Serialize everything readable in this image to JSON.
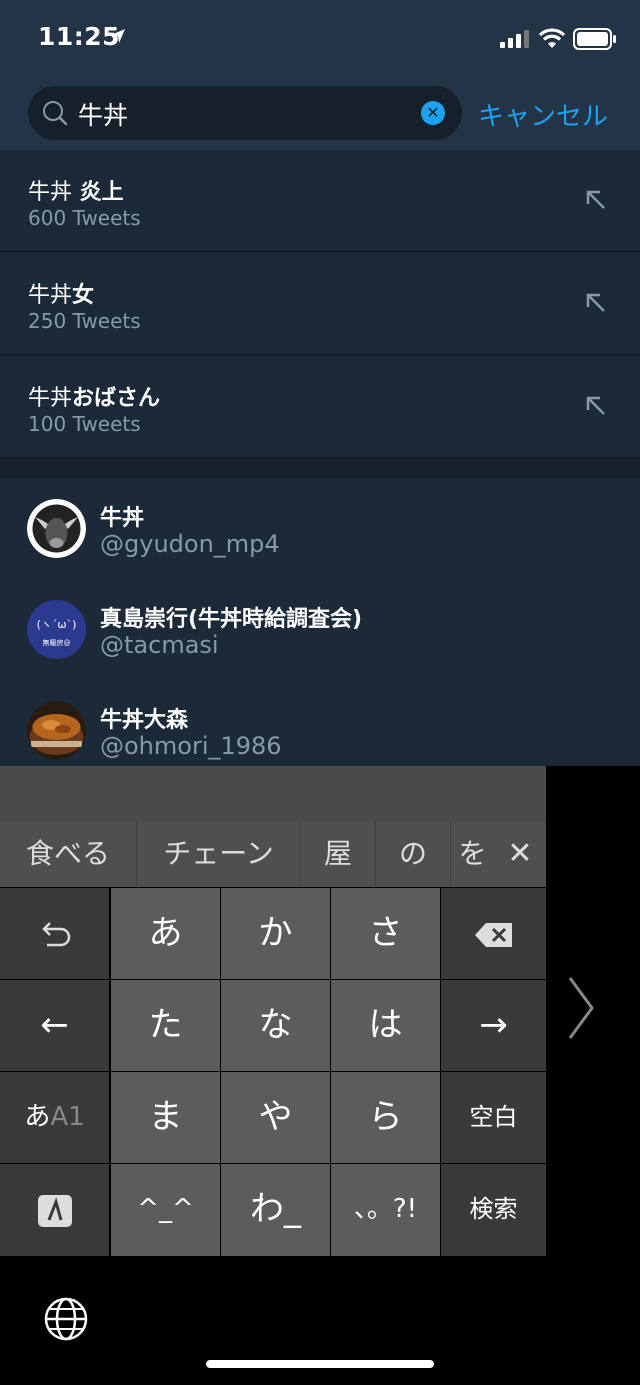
{
  "status_bar": {
    "time": "11:25"
  },
  "search": {
    "query": "牛丼",
    "cancel_label": "キャンセル"
  },
  "suggestions": [
    {
      "prefix": "牛丼",
      "bold": " 炎上",
      "count": "600 Tweets"
    },
    {
      "prefix": "牛丼",
      "bold": "女",
      "count": "250 Tweets"
    },
    {
      "prefix": "牛丼",
      "bold": "おばさん",
      "count": "100 Tweets"
    }
  ],
  "users": [
    {
      "name": "牛丼",
      "handle": "@gyudon_mp4"
    },
    {
      "name": "真島崇行(牛丼時給調査会)",
      "handle": "@tacmasi",
      "avatar_face": "(ヽ´ω`)",
      "avatar_caption": "無暖房@"
    },
    {
      "name": "牛丼大森",
      "handle": "@ohmori_1986"
    }
  ],
  "candidates": [
    "食べる",
    "チェーン",
    "屋",
    "の",
    "を"
  ],
  "keys": {
    "r1": [
      "あ",
      "か",
      "さ"
    ],
    "r2": [
      "←",
      "た",
      "な",
      "は",
      "→"
    ],
    "r3": [
      "ま",
      "や",
      "ら",
      "空白"
    ],
    "r3_mode_main": "あ",
    "r3_mode_sub": "A1",
    "r4": [
      "^_^",
      "わ_",
      "、。?!",
      "検索"
    ]
  },
  "colors": {
    "background": "#15202b",
    "header": "#243447",
    "row": "#1c2938",
    "accent": "#1da1f2",
    "muted": "#8899a6"
  }
}
